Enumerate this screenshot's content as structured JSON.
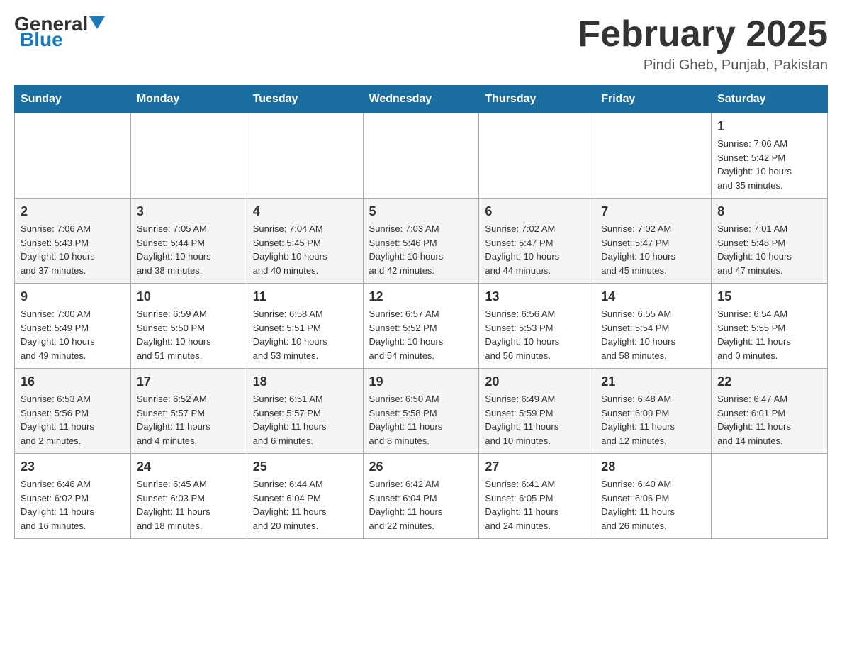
{
  "header": {
    "logo_general": "General",
    "logo_blue": "Blue",
    "month_title": "February 2025",
    "location": "Pindi Gheb, Punjab, Pakistan"
  },
  "weekdays": [
    "Sunday",
    "Monday",
    "Tuesday",
    "Wednesday",
    "Thursday",
    "Friday",
    "Saturday"
  ],
  "weeks": [
    [
      {
        "day": "",
        "info": ""
      },
      {
        "day": "",
        "info": ""
      },
      {
        "day": "",
        "info": ""
      },
      {
        "day": "",
        "info": ""
      },
      {
        "day": "",
        "info": ""
      },
      {
        "day": "",
        "info": ""
      },
      {
        "day": "1",
        "info": "Sunrise: 7:06 AM\nSunset: 5:42 PM\nDaylight: 10 hours\nand 35 minutes."
      }
    ],
    [
      {
        "day": "2",
        "info": "Sunrise: 7:06 AM\nSunset: 5:43 PM\nDaylight: 10 hours\nand 37 minutes."
      },
      {
        "day": "3",
        "info": "Sunrise: 7:05 AM\nSunset: 5:44 PM\nDaylight: 10 hours\nand 38 minutes."
      },
      {
        "day": "4",
        "info": "Sunrise: 7:04 AM\nSunset: 5:45 PM\nDaylight: 10 hours\nand 40 minutes."
      },
      {
        "day": "5",
        "info": "Sunrise: 7:03 AM\nSunset: 5:46 PM\nDaylight: 10 hours\nand 42 minutes."
      },
      {
        "day": "6",
        "info": "Sunrise: 7:02 AM\nSunset: 5:47 PM\nDaylight: 10 hours\nand 44 minutes."
      },
      {
        "day": "7",
        "info": "Sunrise: 7:02 AM\nSunset: 5:47 PM\nDaylight: 10 hours\nand 45 minutes."
      },
      {
        "day": "8",
        "info": "Sunrise: 7:01 AM\nSunset: 5:48 PM\nDaylight: 10 hours\nand 47 minutes."
      }
    ],
    [
      {
        "day": "9",
        "info": "Sunrise: 7:00 AM\nSunset: 5:49 PM\nDaylight: 10 hours\nand 49 minutes."
      },
      {
        "day": "10",
        "info": "Sunrise: 6:59 AM\nSunset: 5:50 PM\nDaylight: 10 hours\nand 51 minutes."
      },
      {
        "day": "11",
        "info": "Sunrise: 6:58 AM\nSunset: 5:51 PM\nDaylight: 10 hours\nand 53 minutes."
      },
      {
        "day": "12",
        "info": "Sunrise: 6:57 AM\nSunset: 5:52 PM\nDaylight: 10 hours\nand 54 minutes."
      },
      {
        "day": "13",
        "info": "Sunrise: 6:56 AM\nSunset: 5:53 PM\nDaylight: 10 hours\nand 56 minutes."
      },
      {
        "day": "14",
        "info": "Sunrise: 6:55 AM\nSunset: 5:54 PM\nDaylight: 10 hours\nand 58 minutes."
      },
      {
        "day": "15",
        "info": "Sunrise: 6:54 AM\nSunset: 5:55 PM\nDaylight: 11 hours\nand 0 minutes."
      }
    ],
    [
      {
        "day": "16",
        "info": "Sunrise: 6:53 AM\nSunset: 5:56 PM\nDaylight: 11 hours\nand 2 minutes."
      },
      {
        "day": "17",
        "info": "Sunrise: 6:52 AM\nSunset: 5:57 PM\nDaylight: 11 hours\nand 4 minutes."
      },
      {
        "day": "18",
        "info": "Sunrise: 6:51 AM\nSunset: 5:57 PM\nDaylight: 11 hours\nand 6 minutes."
      },
      {
        "day": "19",
        "info": "Sunrise: 6:50 AM\nSunset: 5:58 PM\nDaylight: 11 hours\nand 8 minutes."
      },
      {
        "day": "20",
        "info": "Sunrise: 6:49 AM\nSunset: 5:59 PM\nDaylight: 11 hours\nand 10 minutes."
      },
      {
        "day": "21",
        "info": "Sunrise: 6:48 AM\nSunset: 6:00 PM\nDaylight: 11 hours\nand 12 minutes."
      },
      {
        "day": "22",
        "info": "Sunrise: 6:47 AM\nSunset: 6:01 PM\nDaylight: 11 hours\nand 14 minutes."
      }
    ],
    [
      {
        "day": "23",
        "info": "Sunrise: 6:46 AM\nSunset: 6:02 PM\nDaylight: 11 hours\nand 16 minutes."
      },
      {
        "day": "24",
        "info": "Sunrise: 6:45 AM\nSunset: 6:03 PM\nDaylight: 11 hours\nand 18 minutes."
      },
      {
        "day": "25",
        "info": "Sunrise: 6:44 AM\nSunset: 6:04 PM\nDaylight: 11 hours\nand 20 minutes."
      },
      {
        "day": "26",
        "info": "Sunrise: 6:42 AM\nSunset: 6:04 PM\nDaylight: 11 hours\nand 22 minutes."
      },
      {
        "day": "27",
        "info": "Sunrise: 6:41 AM\nSunset: 6:05 PM\nDaylight: 11 hours\nand 24 minutes."
      },
      {
        "day": "28",
        "info": "Sunrise: 6:40 AM\nSunset: 6:06 PM\nDaylight: 11 hours\nand 26 minutes."
      },
      {
        "day": "",
        "info": ""
      }
    ]
  ]
}
